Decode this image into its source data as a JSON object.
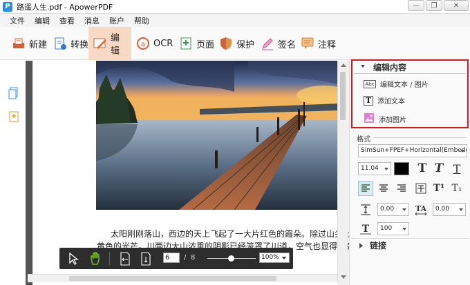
{
  "window": {
    "title": "路遥人生.pdf - ApowerPDF",
    "app_icon_letter": "P",
    "controls": {
      "minimize": "—",
      "restore": "❐",
      "close": "✕"
    }
  },
  "menu": [
    "文件",
    "编辑",
    "查看",
    "消息",
    "账户",
    "帮助"
  ],
  "toolbar": [
    {
      "label": "新建",
      "icon": "new-doc-icon"
    },
    {
      "label": "转换",
      "icon": "convert-icon"
    },
    {
      "label": "编辑",
      "icon": "edit-icon",
      "active": true
    },
    {
      "label": "OCR",
      "icon": "ocr-icon"
    },
    {
      "label": "页面",
      "icon": "page-icon"
    },
    {
      "label": "保护",
      "icon": "shield-icon"
    },
    {
      "label": "签名",
      "icon": "pen-icon"
    },
    {
      "label": "注释",
      "icon": "comment-icon"
    }
  ],
  "document": {
    "line1": "太阳刚刚落山，西边的天上飞起了一大片红色的霞朵。除过山尖上染",
    "line2": "黄色的光芒。川两边大山浓重的阴影已经笼罩了川道，空气也显得凉森森"
  },
  "floating_bar": {
    "current_page": "6",
    "separator": "/",
    "total_pages": "8",
    "zoom": "100%"
  },
  "right_panel": {
    "edit_content_header": "编辑内容",
    "edit_items": [
      {
        "label": "编辑文本 / 图片",
        "icon": "edit-text-image-icon",
        "icon_text": "Abc"
      },
      {
        "label": "添加文本",
        "icon": "add-text-icon",
        "icon_text": "T"
      },
      {
        "label": "添加图片",
        "icon": "add-image-icon",
        "icon_text": ""
      }
    ],
    "format_label": "格式",
    "font_name": "SimSun+FPEF+Horizontal(Embedded)",
    "font_size": "11.04",
    "text_color": "#000000",
    "line_spacing": "0.00",
    "char_spacing": "0.00",
    "scale": "100",
    "style_glyphs": {
      "bold": "T",
      "italic": "T",
      "underline": "T",
      "superscript": "T¹",
      "subscript": "T₁"
    },
    "link_header": "链接"
  },
  "colors": {
    "accent_active": "#f7d9c4",
    "highlight_box": "#e0141b",
    "floating_bar": "#2d2d2d",
    "brand_blue": "#2a8fe0"
  }
}
